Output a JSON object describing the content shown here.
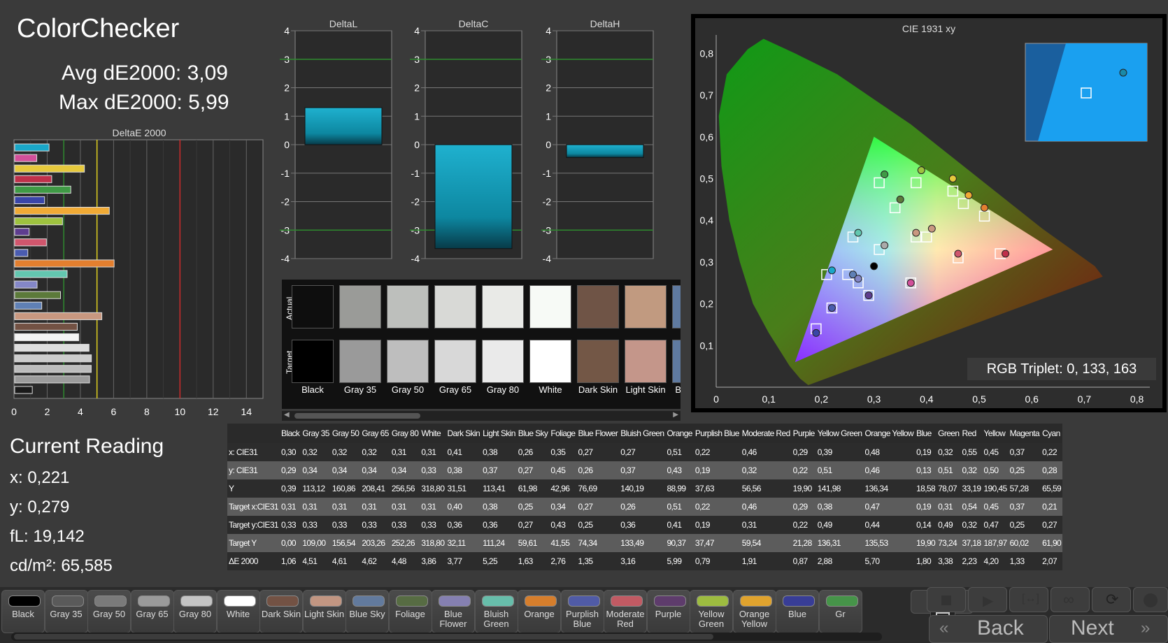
{
  "title": "ColorChecker",
  "avg_label": "Avg dE2000: 3,09",
  "max_label": "Max dE2000: 5,99",
  "current": {
    "heading": "Current Reading",
    "x": "x: 0,221",
    "y": "y: 0,279",
    "fl": "fL: 19,142",
    "cd": "cd/m²: 65,585"
  },
  "chart_data": [
    {
      "type": "bar",
      "title": "DeltaE 2000",
      "orientation": "horizontal",
      "xlim": [
        0,
        15
      ],
      "xticks": [
        0,
        2,
        4,
        6,
        8,
        10,
        12,
        14
      ],
      "reference_lines": [
        3,
        5,
        10
      ],
      "categories": [
        "Cyan",
        "Magenta",
        "Yellow",
        "Red",
        "Green",
        "Blue",
        "Orange Yellow",
        "Yellow Green",
        "Purple",
        "Moderate Red",
        "Purplish Blue",
        "Orange",
        "Bluish Green",
        "Blue Flower",
        "Foliage",
        "Blue Sky",
        "Light Skin",
        "Dark Skin",
        "White",
        "Gray 80",
        "Gray 65",
        "Gray 50",
        "Gray 35",
        "Black"
      ],
      "values": [
        2.07,
        1.33,
        4.2,
        2.23,
        3.38,
        1.8,
        5.7,
        2.88,
        0.87,
        1.91,
        0.79,
        5.99,
        3.16,
        1.35,
        2.76,
        1.63,
        5.25,
        3.77,
        3.86,
        4.48,
        4.62,
        4.61,
        4.51,
        1.06
      ],
      "colors": [
        "#1aa7c8",
        "#d24f9a",
        "#e6c93c",
        "#c0304a",
        "#3f9a45",
        "#3a45a8",
        "#f0aa35",
        "#9ec23f",
        "#5e3d8f",
        "#d0566d",
        "#4a5cb0",
        "#e37f2f",
        "#63c7b0",
        "#8487c8",
        "#5c7a3a",
        "#5f80b5",
        "#c99880",
        "#735244",
        "#f4f4f4",
        "#dedede",
        "#cccccc",
        "#bcbcbc",
        "#9c9c9c",
        "#1a1a1a"
      ]
    },
    {
      "type": "bar",
      "title": "DeltaL",
      "ylim": [
        -4,
        4
      ],
      "yticks": [
        4,
        3,
        2,
        1,
        0,
        -1,
        -2,
        -3,
        -4
      ],
      "reference_lines": [
        3,
        -3
      ],
      "values": [
        1.3
      ]
    },
    {
      "type": "bar",
      "title": "DeltaC",
      "ylim": [
        -4,
        4
      ],
      "yticks": [
        4,
        3,
        2,
        1,
        0,
        -1,
        -2,
        -3,
        -4
      ],
      "reference_lines": [
        3,
        -3
      ],
      "values": [
        -3.65
      ]
    },
    {
      "type": "bar",
      "title": "DeltaH",
      "ylim": [
        -4,
        4
      ],
      "yticks": [
        4,
        3,
        2,
        1,
        0,
        -1,
        -2,
        -3,
        -4
      ],
      "reference_lines": [
        3,
        -3
      ],
      "values": [
        -0.45
      ]
    },
    {
      "type": "scatter",
      "title": "CIE 1931 xy",
      "xlim": [
        0,
        0.85
      ],
      "ylim": [
        0,
        0.85
      ],
      "xticks": [
        "0",
        "0,1",
        "0,2",
        "0,3",
        "0,4",
        "0,5",
        "0,6",
        "0,7",
        "0,8"
      ],
      "yticks": [
        "0",
        "0,1",
        "0,2",
        "0,3",
        "0,4",
        "0,5",
        "0,6",
        "0,7",
        "0,8"
      ],
      "gamut_triangle": [
        [
          0.64,
          0.33
        ],
        [
          0.3,
          0.6
        ],
        [
          0.15,
          0.06
        ]
      ],
      "target_squares": [
        [
          0.19,
          0.14
        ],
        [
          0.31,
          0.49
        ],
        [
          0.54,
          0.32
        ],
        [
          0.45,
          0.47
        ],
        [
          0.37,
          0.25
        ],
        [
          0.21,
          0.27
        ],
        [
          0.31,
          0.33
        ],
        [
          0.4,
          0.36
        ],
        [
          0.38,
          0.36
        ],
        [
          0.25,
          0.27
        ],
        [
          0.34,
          0.43
        ],
        [
          0.27,
          0.25
        ],
        [
          0.51,
          0.41
        ],
        [
          0.22,
          0.19
        ],
        [
          0.46,
          0.31
        ],
        [
          0.29,
          0.22
        ],
        [
          0.38,
          0.49
        ],
        [
          0.47,
          0.44
        ],
        [
          0.26,
          0.36
        ],
        [
          0.37,
          0.25
        ]
      ],
      "measured_points": [
        {
          "x": 0.19,
          "y": 0.13,
          "color": "#3a45a8"
        },
        {
          "x": 0.32,
          "y": 0.51,
          "color": "#3f9a45"
        },
        {
          "x": 0.55,
          "y": 0.32,
          "color": "#c0304a"
        },
        {
          "x": 0.45,
          "y": 0.5,
          "color": "#e6c93c"
        },
        {
          "x": 0.37,
          "y": 0.25,
          "color": "#d24f9a"
        },
        {
          "x": 0.22,
          "y": 0.28,
          "color": "#1aa7c8"
        },
        {
          "x": 0.32,
          "y": 0.34,
          "color": "#aaaaaa"
        },
        {
          "x": 0.41,
          "y": 0.38,
          "color": "#c99880"
        },
        {
          "x": 0.38,
          "y": 0.37,
          "color": "#c99880"
        },
        {
          "x": 0.26,
          "y": 0.27,
          "color": "#5f80b5"
        },
        {
          "x": 0.35,
          "y": 0.45,
          "color": "#5c7a3a"
        },
        {
          "x": 0.27,
          "y": 0.26,
          "color": "#8487c8"
        },
        {
          "x": 0.51,
          "y": 0.43,
          "color": "#e37f2f"
        },
        {
          "x": 0.22,
          "y": 0.19,
          "color": "#4a5cb0"
        },
        {
          "x": 0.46,
          "y": 0.32,
          "color": "#d0566d"
        },
        {
          "x": 0.29,
          "y": 0.22,
          "color": "#5e3d8f"
        },
        {
          "x": 0.39,
          "y": 0.52,
          "color": "#9ec23f"
        },
        {
          "x": 0.48,
          "y": 0.46,
          "color": "#f0aa35"
        },
        {
          "x": 0.27,
          "y": 0.37,
          "color": "#63c7b0"
        },
        {
          "x": 0.3,
          "y": 0.29,
          "color": "#000000"
        }
      ],
      "inset_target": [
        0.221,
        0.279
      ],
      "annotation": "RGB Triplet: 0, 133, 163"
    }
  ],
  "swatches": {
    "row_labels": [
      "Actual",
      "Target"
    ],
    "items": [
      {
        "name": "Black",
        "actual": "#0e0e0e",
        "target": "#000000"
      },
      {
        "name": "Gray 35",
        "actual": "#9a9b98",
        "target": "#9a9a9a"
      },
      {
        "name": "Gray 50",
        "actual": "#bdbfbc",
        "target": "#bebebe"
      },
      {
        "name": "Gray 65",
        "actual": "#d8d9d6",
        "target": "#d8d8d8"
      },
      {
        "name": "Gray 80",
        "actual": "#e9eae7",
        "target": "#eaeaea"
      },
      {
        "name": "White",
        "actual": "#f7faf6",
        "target": "#ffffff"
      },
      {
        "name": "Dark Skin",
        "actual": "#6f5446",
        "target": "#735746"
      },
      {
        "name": "Light Skin",
        "actual": "#c19a80",
        "target": "#c4968a"
      },
      {
        "name": "Blue Sky",
        "actual": "#5f7aa0",
        "target": "#5f7aa0"
      }
    ]
  },
  "table": {
    "headers": [
      "",
      "Black",
      "Gray 35",
      "Gray 50",
      "Gray 65",
      "Gray 80",
      "White",
      "Dark Skin",
      "Light Skin",
      "Blue Sky",
      "Foliage",
      "Blue Flower",
      "Bluish Green",
      "Orange",
      "Purplish Blue",
      "Moderate Red",
      "Purple",
      "Yellow Green",
      "Orange Yellow",
      "Blue",
      "Green",
      "Red",
      "Yellow",
      "Magenta",
      "Cyan"
    ],
    "rows": [
      [
        "x: CIE31",
        "0,30",
        "0,32",
        "0,32",
        "0,32",
        "0,31",
        "0,31",
        "0,41",
        "0,38",
        "0,26",
        "0,35",
        "0,27",
        "0,27",
        "0,51",
        "0,22",
        "0,46",
        "0,29",
        "0,39",
        "0,48",
        "0,19",
        "0,32",
        "0,55",
        "0,45",
        "0,37",
        "0,22"
      ],
      [
        "y: CIE31",
        "0,29",
        "0,34",
        "0,34",
        "0,34",
        "0,34",
        "0,33",
        "0,38",
        "0,37",
        "0,27",
        "0,45",
        "0,26",
        "0,37",
        "0,43",
        "0,19",
        "0,32",
        "0,22",
        "0,51",
        "0,46",
        "0,13",
        "0,51",
        "0,32",
        "0,50",
        "0,25",
        "0,28"
      ],
      [
        "Y",
        "0,39",
        "113,12",
        "160,86",
        "208,41",
        "256,56",
        "318,80",
        "31,51",
        "113,41",
        "61,98",
        "42,96",
        "76,69",
        "140,19",
        "88,99",
        "37,63",
        "56,56",
        "19,90",
        "141,98",
        "136,34",
        "18,58",
        "78,07",
        "33,19",
        "190,45",
        "57,28",
        "65,59"
      ],
      [
        "Target x:CIE31",
        "0,31",
        "0,31",
        "0,31",
        "0,31",
        "0,31",
        "0,31",
        "0,40",
        "0,38",
        "0,25",
        "0,34",
        "0,27",
        "0,26",
        "0,51",
        "0,22",
        "0,46",
        "0,29",
        "0,38",
        "0,47",
        "0,19",
        "0,31",
        "0,54",
        "0,45",
        "0,37",
        "0,21"
      ],
      [
        "Target y:CIE31",
        "0,33",
        "0,33",
        "0,33",
        "0,33",
        "0,33",
        "0,33",
        "0,36",
        "0,36",
        "0,27",
        "0,43",
        "0,25",
        "0,36",
        "0,41",
        "0,19",
        "0,31",
        "0,22",
        "0,49",
        "0,44",
        "0,14",
        "0,49",
        "0,32",
        "0,47",
        "0,25",
        "0,27"
      ],
      [
        "Target Y",
        "0,00",
        "109,00",
        "156,54",
        "203,26",
        "252,26",
        "318,80",
        "32,11",
        "111,24",
        "59,61",
        "41,55",
        "74,34",
        "133,49",
        "90,37",
        "37,47",
        "59,54",
        "21,28",
        "136,31",
        "135,53",
        "19,90",
        "73,24",
        "37,18",
        "187,97",
        "60,02",
        "61,90"
      ],
      [
        "ΔE 2000",
        "1,06",
        "4,51",
        "4,61",
        "4,62",
        "4,48",
        "3,86",
        "3,77",
        "5,25",
        "1,63",
        "2,76",
        "1,35",
        "3,16",
        "5,99",
        "0,79",
        "1,91",
        "0,87",
        "2,88",
        "5,70",
        "1,80",
        "3,38",
        "2,23",
        "4,20",
        "1,33",
        "2,07"
      ]
    ]
  },
  "bottom_buttons": [
    {
      "label": "Black",
      "color": "#000000"
    },
    {
      "label": "Gray 35",
      "color": "#5a5a5a"
    },
    {
      "label": "Gray 50",
      "color": "#7a7a7a"
    },
    {
      "label": "Gray 65",
      "color": "#9a9a9a"
    },
    {
      "label": "Gray 80",
      "color": "#c4c4c4"
    },
    {
      "label": "White",
      "color": "#ffffff"
    },
    {
      "label": "Dark Skin",
      "color": "#735244"
    },
    {
      "label": "Light Skin",
      "color": "#c29682"
    },
    {
      "label": "Blue Sky",
      "color": "#627a9d"
    },
    {
      "label": "Foliage",
      "color": "#576c43"
    },
    {
      "label": "Blue Flower",
      "color": "#8580b1"
    },
    {
      "label": "Bluish Green",
      "color": "#67bdaa"
    },
    {
      "label": "Orange",
      "color": "#d67e2c"
    },
    {
      "label": "Purplish Blue",
      "color": "#505ba6"
    },
    {
      "label": "Moderate Red",
      "color": "#c15a63"
    },
    {
      "label": "Purple",
      "color": "#5e3c6c"
    },
    {
      "label": "Yellow Green",
      "color": "#9dbc40"
    },
    {
      "label": "Orange Yellow",
      "color": "#e0a32e"
    },
    {
      "label": "Blue",
      "color": "#383d96"
    },
    {
      "label": "Gr",
      "color": "#469449"
    }
  ],
  "nav": {
    "back": "Back",
    "next": "Next"
  }
}
